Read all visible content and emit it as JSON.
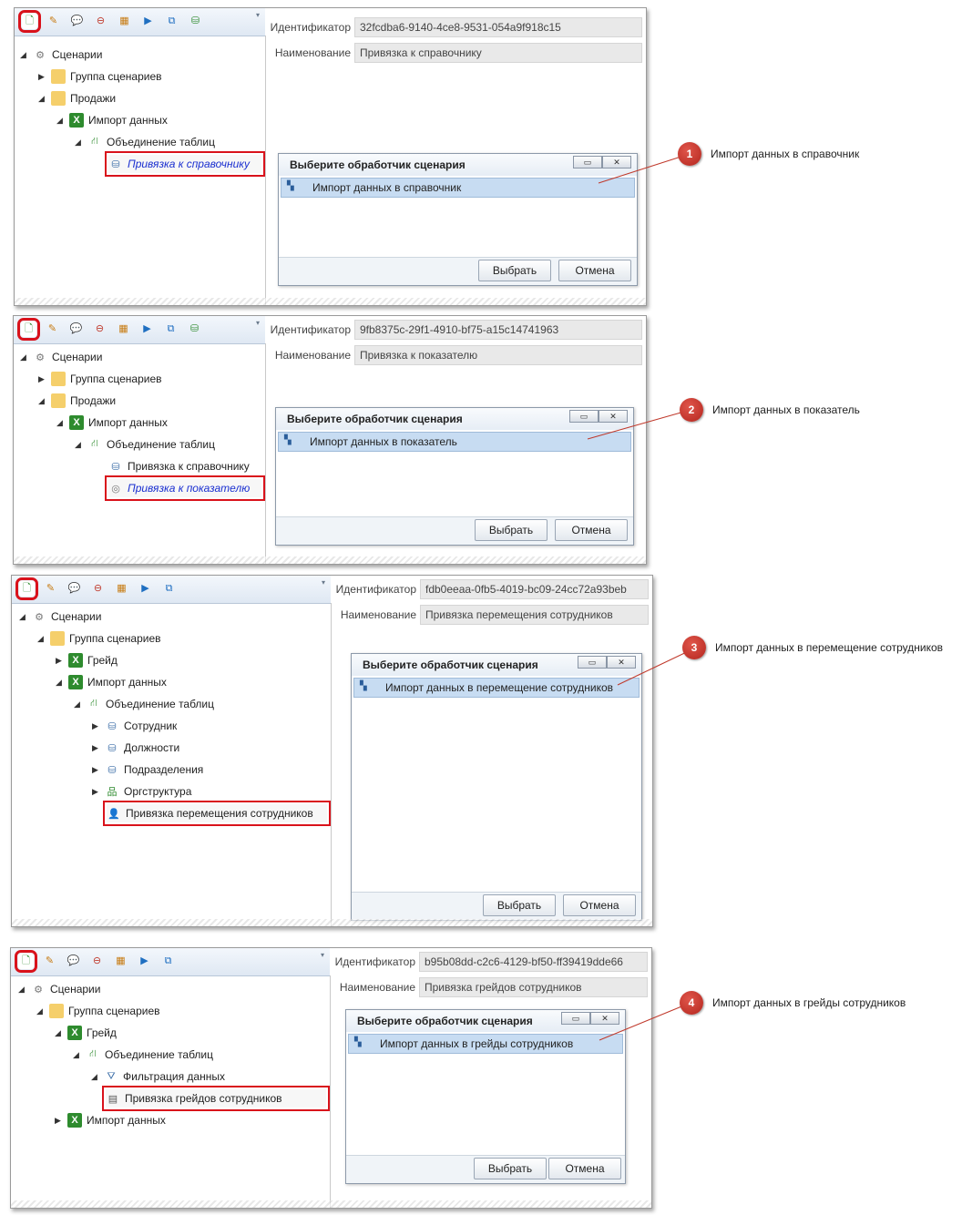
{
  "colors": {
    "highlight_red": "#d9121b",
    "badge_red": "#c0392b",
    "selected_link": "#1a2fd0",
    "dialog_selection": "#c7dcf2"
  },
  "dialog_title": "Выберите обработчик сценария",
  "prop_labels": {
    "id": "Идентификатор",
    "name": "Наименование"
  },
  "buttons": {
    "select": "Выбрать",
    "cancel": "Отмена"
  },
  "toolbar_icons": [
    "new-scenario-icon",
    "edit-icon",
    "comment-icon",
    "delete-icon",
    "table-icon",
    "run-icon",
    "copy-icon",
    "export-icon"
  ],
  "panels": [
    {
      "identifier": "32fcdba6-9140-4ce8-9531-054a9f918c15",
      "name": "Привязка к справочнику",
      "tree": [
        "Сценарии",
        "Группа сценариев",
        "Продажи",
        "Импорт данных",
        "Объединение таблиц",
        "Привязка к справочнику"
      ],
      "dialog_item": "Импорт данных в справочник",
      "callout": {
        "number": "1",
        "text": "Импорт данных в справочник"
      }
    },
    {
      "identifier": "9fb8375c-29f1-4910-bf75-a15c14741963",
      "name": "Привязка к показателю",
      "tree": [
        "Сценарии",
        "Группа сценариев",
        "Продажи",
        "Импорт данных",
        "Объединение таблиц",
        "Привязка к справочнику",
        "Привязка к показателю"
      ],
      "dialog_item": "Импорт данных в показатель",
      "callout": {
        "number": "2",
        "text": "Импорт данных в показатель"
      }
    },
    {
      "identifier": "fdb0eeaa-0fb5-4019-bc09-24cc72a93beb",
      "name": "Привязка перемещения сотрудников",
      "tree": [
        "Сценарии",
        "Группа сценариев",
        "Грейд",
        "Импорт данных",
        "Объединение таблиц",
        "Сотрудник",
        "Должности",
        "Подразделения",
        "Оргструктура",
        "Привязка перемещения сотрудников"
      ],
      "dialog_item": "Импорт данных в перемещение сотрудников",
      "callout": {
        "number": "3",
        "text": "Импорт данных в перемещение сотрудников"
      }
    },
    {
      "identifier": "b95b08dd-c2c6-4129-bf50-ff39419dde66",
      "name": "Привязка грейдов сотрудников",
      "tree": [
        "Сценарии",
        "Группа сценариев",
        "Грейд",
        "Объединение таблиц",
        "Фильтрация данных",
        "Привязка грейдов сотрудников",
        "Импорт данных"
      ],
      "dialog_item": "Импорт данных в грейды сотрудников",
      "callout": {
        "number": "4",
        "text": "Импорт данных в грейды сотрудников"
      }
    }
  ]
}
